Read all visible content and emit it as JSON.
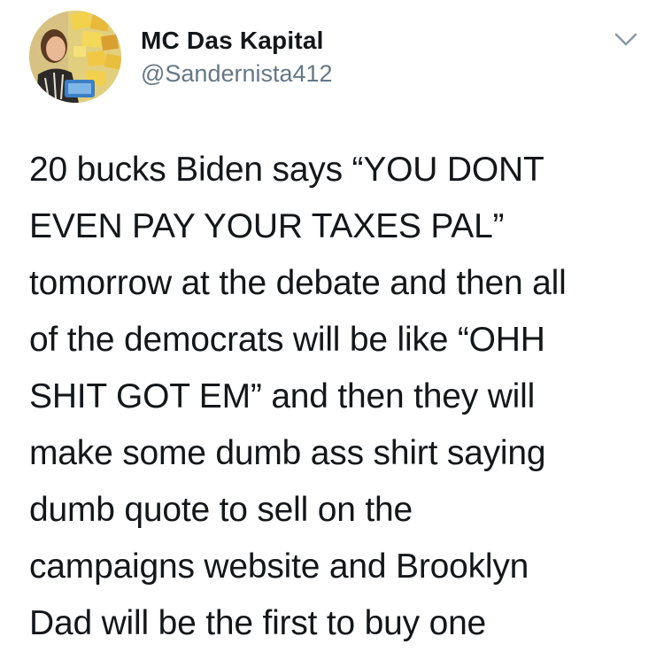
{
  "tweet": {
    "author": {
      "display_name": "MC Das Kapital",
      "handle": "@Sandernista412",
      "avatar_icon": "profile-photo"
    },
    "menu_icon": "chevron-down-icon",
    "text_lines": [
      "20 bucks Biden says “YOU DONT",
      "EVEN PAY YOUR TAXES PAL”",
      "tomorrow at the debate and then all",
      "of the democrats will be like “OHH",
      "SHIT GOT EM” and then they will",
      "make some dumb ass shirt saying",
      "dumb quote to sell on the",
      "campaigns website and Brooklyn",
      "Dad will be the first to buy one"
    ]
  },
  "colors": {
    "name": "#14171a",
    "handle": "#657786",
    "caret": "#8899a6",
    "background": "#ffffff"
  }
}
